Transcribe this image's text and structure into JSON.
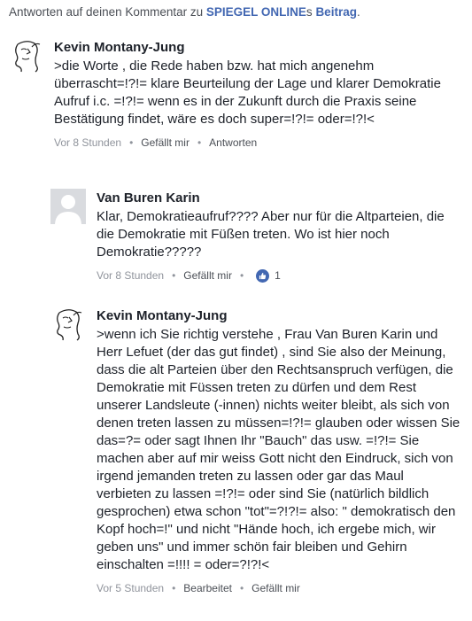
{
  "header": {
    "prefix": "Antworten auf deinen Kommentar zu ",
    "publication": "SPIEGEL ONLINE",
    "possessive": "s ",
    "article": "Beitrag",
    "suffix": "."
  },
  "comments": [
    {
      "author": "Kevin Montany-Jung",
      "text": ">die Worte , die Rede haben bzw. hat mich angenehm überrascht=!?!= klare Beurteilung der Lage und klarer Demokratie  Aufruf i.c. =!?!= wenn es in der Zukunft durch die Praxis seine Bestätigung findet, wäre  es doch super=!?!= oder=!?!<",
      "time": "Vor 8 Stunden",
      "like": "Gefällt mir",
      "reply": "Antworten"
    },
    {
      "author": "Van Buren Karin",
      "text": "Klar, Demokratieaufruf???? Aber nur für die Altparteien, die die Demokratie mit Füßen treten. Wo ist hier noch Demokratie?????",
      "time": "Vor 8 Stunden",
      "like": "Gefällt mir",
      "like_count": "1"
    },
    {
      "author": "Kevin Montany-Jung",
      "text": ">wenn ich Sie richtig verstehe , Frau Van Buren Karin und Herr Lefuet (der das gut findet)  ,  sind Sie also der Meinung, dass  die alt Parteien über den Rechtsanspruch verfügen, die Demokratie mit Füssen treten zu dürfen und dem Rest unserer  Landsleute (-innen)  nichts weiter bleibt, als sich von denen treten lassen zu müssen=!?!= glauben oder wissen Sie das=?= oder sagt Ihnen Ihr \"Bauch\" das usw. =!?!= Sie machen aber auf mir  weiss Gott nicht den Eindruck, sich von irgend jemanden treten zu lassen oder gar das Maul verbieten zu lassen =!?!= oder sind Sie  (natürlich bildlich gesprochen)  etwa schon \"tot\"=?!?!= also: \" demokratisch den Kopf hoch=!\" und nicht \"Hände hoch, ich ergebe mich, wir geben uns\" und immer schön fair bleiben und Gehirn einschalten =!!!! = oder=?!?!<",
      "time": "Vor 5 Stunden",
      "edited": "Bearbeitet",
      "like": "Gefällt mir"
    }
  ],
  "colors": {
    "link_blue": "#4267b2",
    "meta_gray": "#90949c",
    "text": "#1d2129"
  }
}
